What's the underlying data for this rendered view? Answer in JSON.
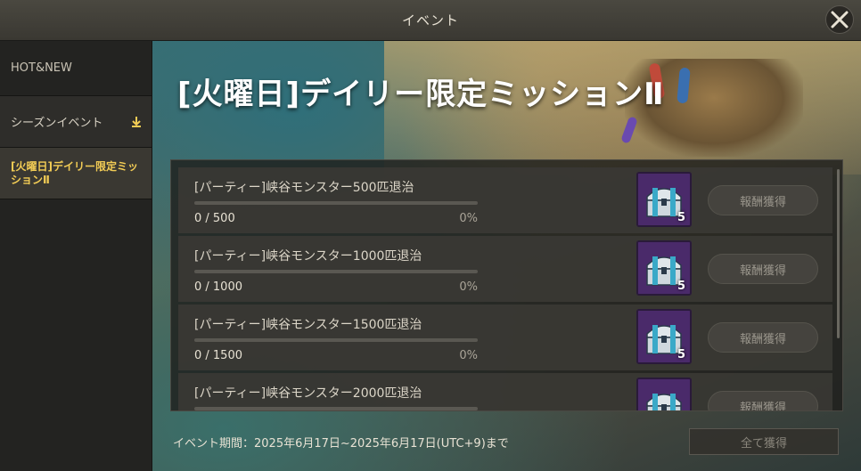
{
  "window": {
    "title": "イベント"
  },
  "sidebar": {
    "items": [
      {
        "label": "HOT&NEW"
      },
      {
        "label": "シーズンイベント"
      },
      {
        "label": "[火曜日]デイリー限定ミッションⅡ"
      }
    ]
  },
  "event": {
    "title": "[火曜日]デイリー限定ミッションⅡ",
    "period": "イベント期間：2025年6月17日~2025年6月17日(UTC+9)まで",
    "claim_all_label": "全て獲得"
  },
  "missions": [
    {
      "name": "[パーティー]峡谷モンスター500匹退治",
      "progress": "0 / 500",
      "percent": "0%",
      "reward_qty": "5",
      "claim_label": "報酬獲得"
    },
    {
      "name": "[パーティー]峡谷モンスター1000匹退治",
      "progress": "0 / 1000",
      "percent": "0%",
      "reward_qty": "5",
      "claim_label": "報酬獲得"
    },
    {
      "name": "[パーティー]峡谷モンスター1500匹退治",
      "progress": "0 / 1500",
      "percent": "0%",
      "reward_qty": "5",
      "claim_label": "報酬獲得"
    },
    {
      "name": "[パーティー]峡谷モンスター2000匹退治",
      "progress": "",
      "percent": "",
      "reward_qty": "",
      "claim_label": "報酬獲得"
    }
  ],
  "icons": {
    "close": "close-icon",
    "reward": "treasure-chest-icon",
    "expand": "chevron-down-icon"
  },
  "colors": {
    "accent": "#f2cc55",
    "chest": "#4a2a6a"
  }
}
